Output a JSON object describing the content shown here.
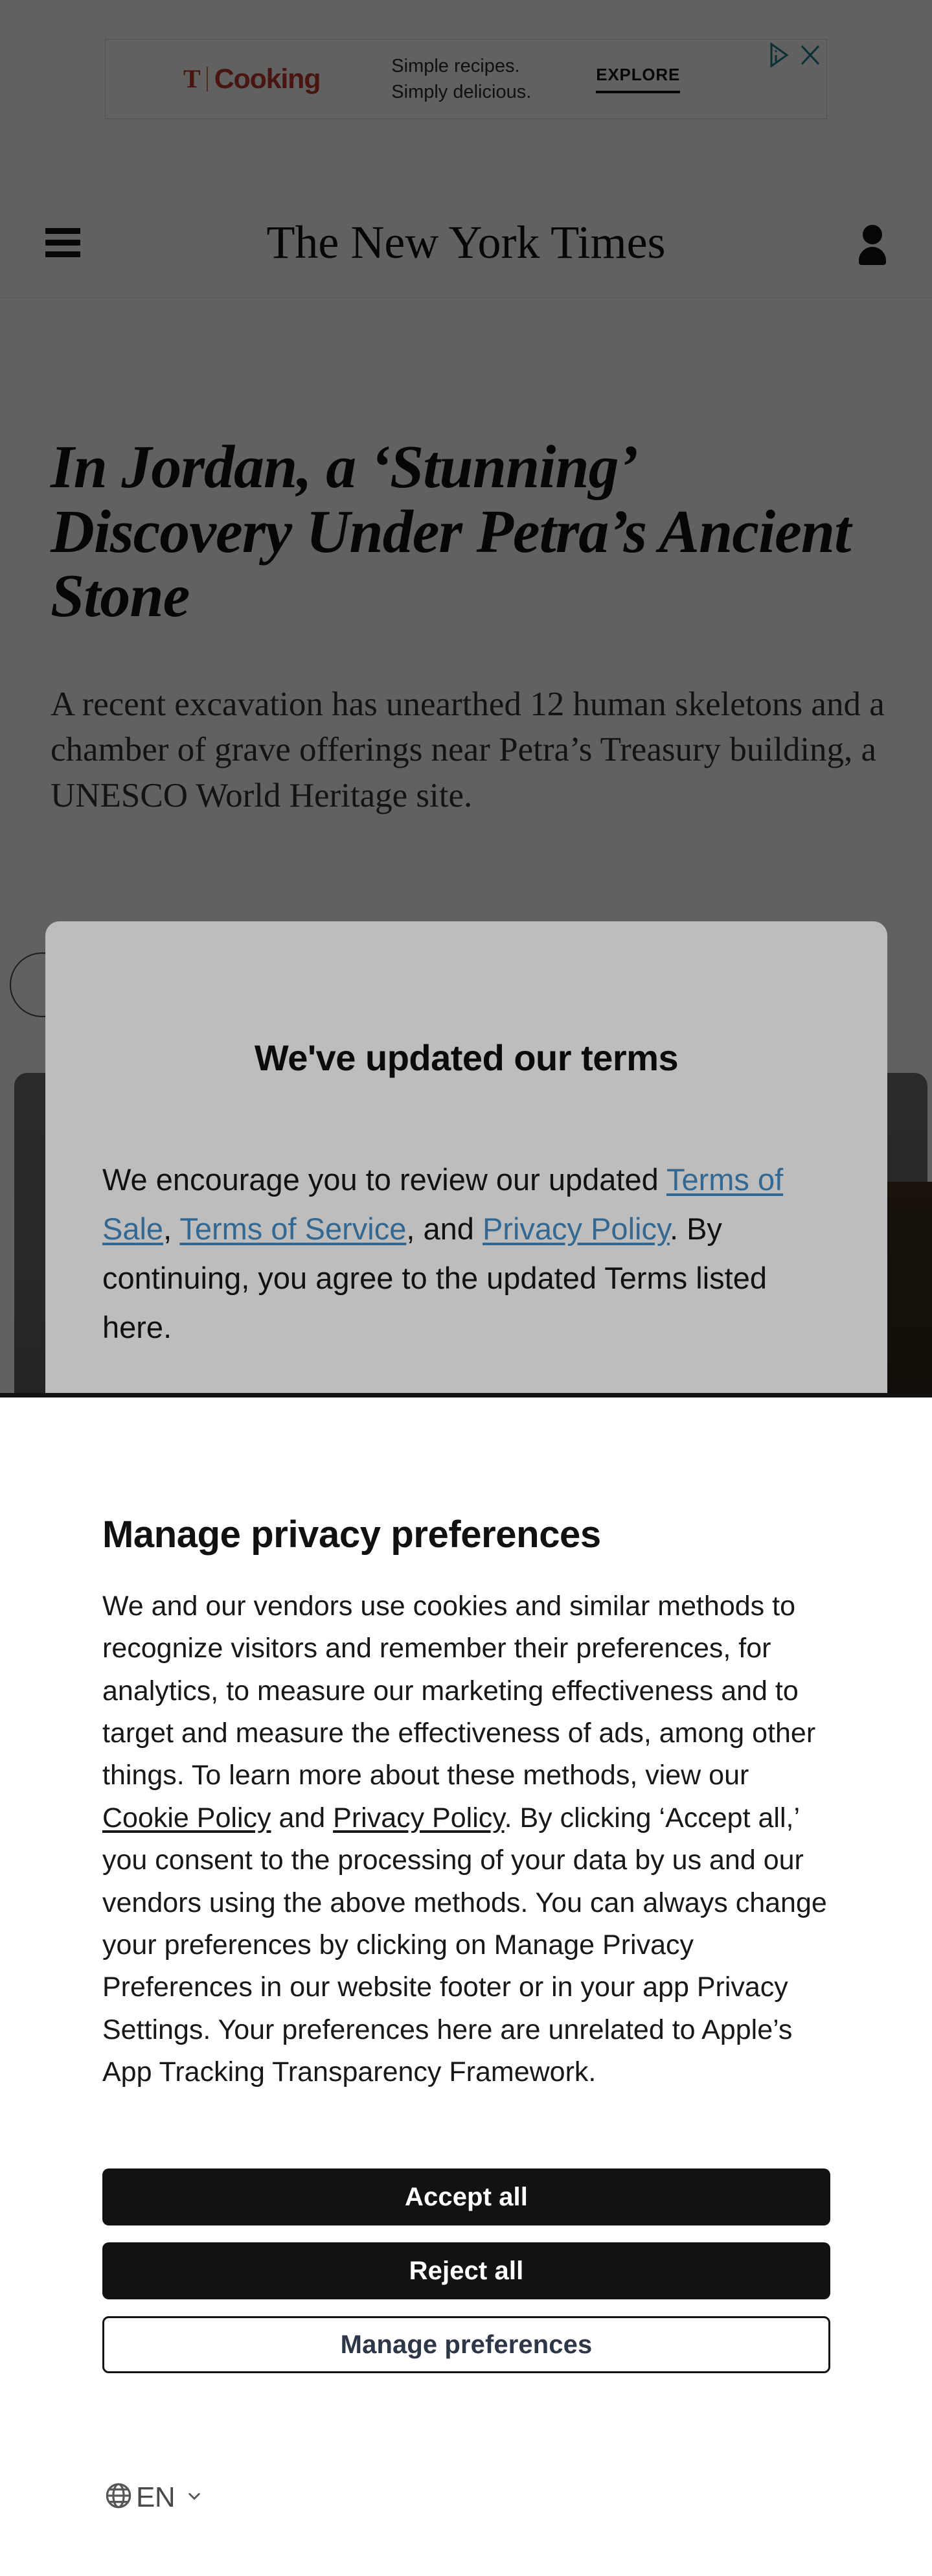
{
  "ad": {
    "brand_t": "T",
    "brand_name": "Cooking",
    "line1": "Simple recipes.",
    "line2": "Simply delicious.",
    "cta": "EXPLORE",
    "adchoices_icon": "adchoices-icon",
    "close_icon": "close-icon",
    "brand_color": "#c0392b",
    "icon_color": "#1b7f8e"
  },
  "masthead": {
    "menu_icon": "hamburger-menu-icon",
    "logo": "The New York Times",
    "account_icon": "account-person-icon"
  },
  "article": {
    "headline": "In Jordan, a ‘Stunning’ Discovery Under Petra’s Ancient Stone",
    "summary": "A recent excavation has unearthed 12 human skeletons and a chamber of grave offerings near Petra’s Treasury building, a UNESCO World Heritage site."
  },
  "terms_modal": {
    "title": "We've updated our terms",
    "text_before": "We encourage you to review our updated ",
    "link_sale": "Terms of Sale",
    "sep1": ", ",
    "link_service": "Terms of Service",
    "sep2": ", and ",
    "link_privacy": "Privacy Policy",
    "text_after": ". By continuing, you agree to the updated Terms listed here.",
    "link_color": "#326891",
    "background": "#bdbdbd"
  },
  "privacy": {
    "title": "Manage privacy preferences",
    "body_p1": "We and our vendors use cookies and similar methods to recognize visitors and remember their preferences, for analytics, to measure our marketing effectiveness and to target and measure the effectiveness of ads, among other things. To learn more about these methods, view our ",
    "link_cookie": "Cookie Policy",
    "body_and": " and ",
    "link_privacy": "Privacy Policy",
    "body_p2": ". By clicking ‘Accept all,’ you consent to the processing of your data by us and our vendors using the above methods. You can always change your preferences by clicking on Manage Privacy Preferences in our website footer or in your app Privacy Settings. Your preferences here are unrelated to Apple’s App Tracking Transparency Framework.",
    "buttons": [
      {
        "label": "Accept all",
        "style": "dark"
      },
      {
        "label": "Reject all",
        "style": "dark"
      },
      {
        "label": "Manage preferences",
        "style": "outline"
      }
    ],
    "language": {
      "globe_icon": "globe-icon",
      "code": "EN",
      "chevron_icon": "chevron-down-icon"
    },
    "accent_dark": "#121212",
    "outline_text": "#2e3748"
  }
}
